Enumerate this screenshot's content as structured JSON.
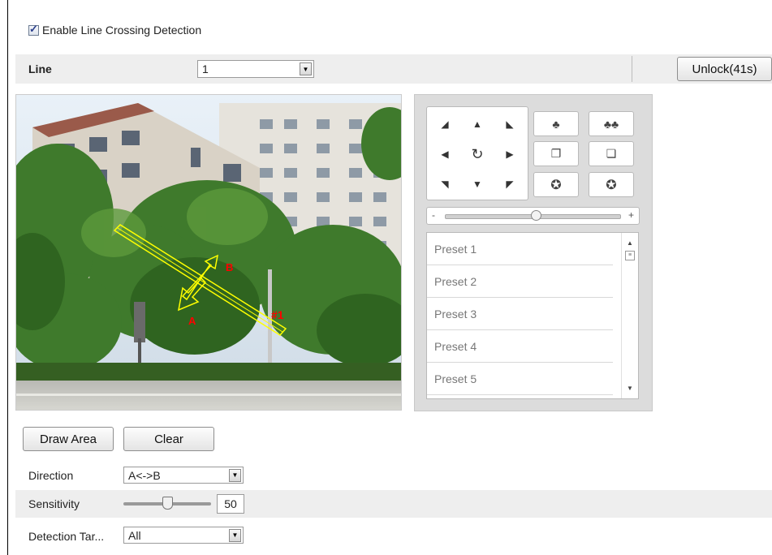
{
  "enable": {
    "label": "Enable Line Crossing Detection",
    "checked": true
  },
  "line": {
    "label": "Line",
    "value": "1"
  },
  "unlock": {
    "label": "Unlock(41s)"
  },
  "video": {
    "marker_a": "A",
    "marker_b": "B",
    "line_tag": "#1"
  },
  "ptz": {
    "zoom_minus": "-",
    "zoom_plus": "+",
    "zoom_level": 0.52,
    "presets": [
      "Preset 1",
      "Preset 2",
      "Preset 3",
      "Preset 4",
      "Preset 5"
    ]
  },
  "buttons": {
    "draw_area": "Draw Area",
    "clear": "Clear"
  },
  "direction": {
    "label": "Direction",
    "value": "A<->B"
  },
  "sensitivity": {
    "label": "Sensitivity",
    "value": "50",
    "level": 0.5
  },
  "detection_target": {
    "label": "Detection Tar...",
    "value": "All"
  },
  "colors": {
    "line_yellow": "#ffff00",
    "marker_red": "#ff0000",
    "panel_gray": "#dcdcdc"
  }
}
